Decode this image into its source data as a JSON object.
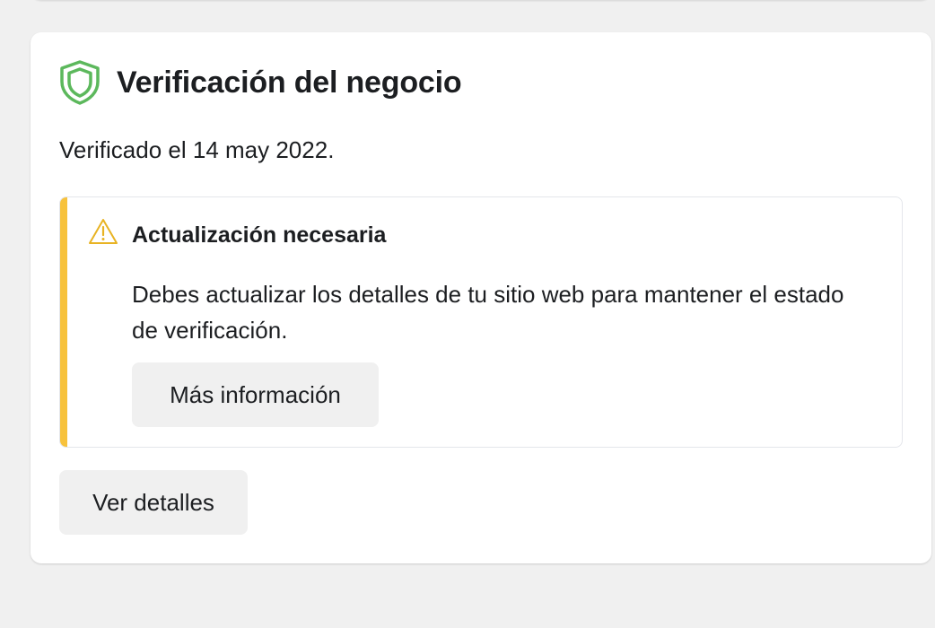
{
  "card": {
    "title": "Verificación del negocio",
    "icon": "shield-icon",
    "status_text": "Verificado el 14 may 2022.",
    "details_button": "Ver detalles"
  },
  "alert": {
    "icon": "warning-icon",
    "title": "Actualización necesaria",
    "body": "Debes actualizar los detalles de tu sitio web para mantener el estado de verificación.",
    "button": "Más información"
  },
  "colors": {
    "shield": "#5cb85c",
    "warning_accent": "#f7c23c",
    "button_bg": "#f0f0f0",
    "page_bg": "#f0f0f0"
  }
}
